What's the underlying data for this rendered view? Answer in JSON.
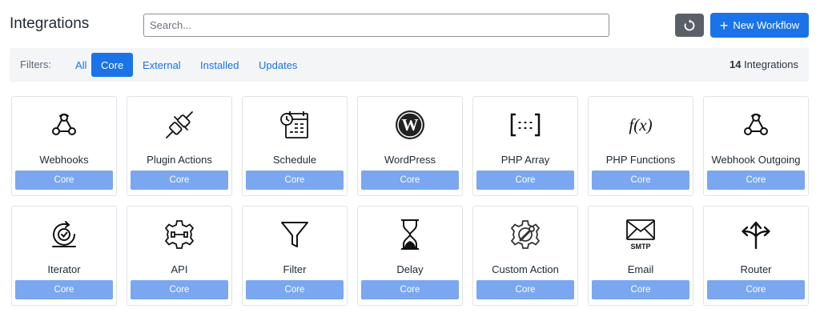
{
  "header": {
    "title": "Integrations",
    "search_placeholder": "Search...",
    "new_workflow_label": "New Workflow"
  },
  "filters": {
    "label": "Filters:",
    "items": [
      "All",
      "Core",
      "External",
      "Installed",
      "Updates"
    ],
    "active": "Core",
    "count_number": "14",
    "count_label": "Integrations"
  },
  "cards": [
    {
      "name": "Webhooks",
      "badge": "Core",
      "icon": "webhook-icon"
    },
    {
      "name": "Plugin Actions",
      "badge": "Core",
      "icon": "plug-icon"
    },
    {
      "name": "Schedule",
      "badge": "Core",
      "icon": "calendar-clock-icon"
    },
    {
      "name": "WordPress",
      "badge": "Core",
      "icon": "wordpress-icon"
    },
    {
      "name": "PHP Array",
      "badge": "Core",
      "icon": "array-brackets-icon"
    },
    {
      "name": "PHP Functions",
      "badge": "Core",
      "icon": "function-icon"
    },
    {
      "name": "Webhook Outgoing",
      "badge": "Core",
      "icon": "webhook-icon"
    },
    {
      "name": "Iterator",
      "badge": "Core",
      "icon": "iterator-icon"
    },
    {
      "name": "API",
      "badge": "Core",
      "icon": "api-gear-icon"
    },
    {
      "name": "Filter",
      "badge": "Core",
      "icon": "funnel-icon"
    },
    {
      "name": "Delay",
      "badge": "Core",
      "icon": "hourglass-icon"
    },
    {
      "name": "Custom Action",
      "badge": "Core",
      "icon": "gear-wrench-icon"
    },
    {
      "name": "Email",
      "badge": "Core",
      "icon": "smtp-envelope-icon"
    },
    {
      "name": "Router",
      "badge": "Core",
      "icon": "router-arrows-icon"
    }
  ],
  "colors": {
    "accent": "#1a73e8",
    "badge": "#7aa7f0",
    "refresh_button": "#5b6068"
  }
}
